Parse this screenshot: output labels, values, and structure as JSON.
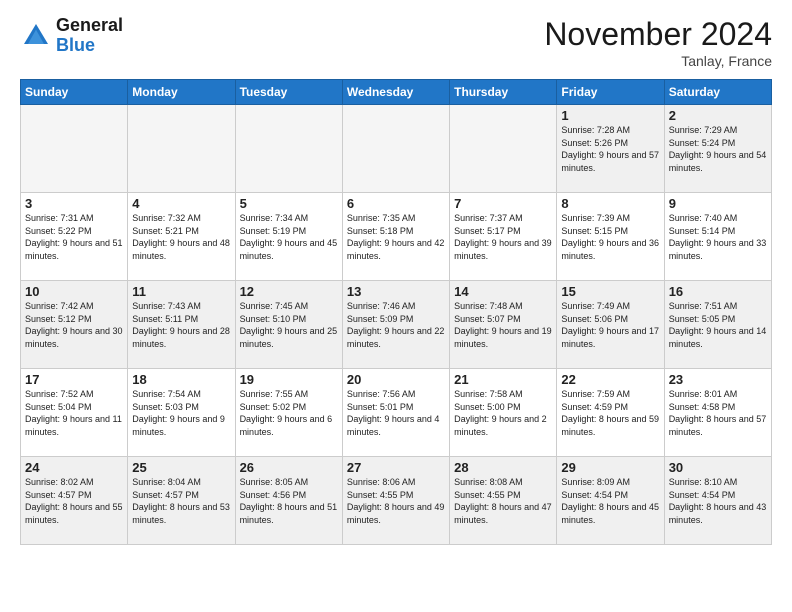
{
  "header": {
    "logo_line1": "General",
    "logo_line2": "Blue",
    "month_title": "November 2024",
    "location": "Tanlay, France"
  },
  "weekdays": [
    "Sunday",
    "Monday",
    "Tuesday",
    "Wednesday",
    "Thursday",
    "Friday",
    "Saturday"
  ],
  "weeks": [
    [
      {
        "day": "",
        "empty": true
      },
      {
        "day": "",
        "empty": true
      },
      {
        "day": "",
        "empty": true
      },
      {
        "day": "",
        "empty": true
      },
      {
        "day": "",
        "empty": true
      },
      {
        "day": "1",
        "sunrise": "7:28 AM",
        "sunset": "5:26 PM",
        "daylight": "9 hours and 57 minutes."
      },
      {
        "day": "2",
        "sunrise": "7:29 AM",
        "sunset": "5:24 PM",
        "daylight": "9 hours and 54 minutes."
      }
    ],
    [
      {
        "day": "3",
        "sunrise": "7:31 AM",
        "sunset": "5:22 PM",
        "daylight": "9 hours and 51 minutes."
      },
      {
        "day": "4",
        "sunrise": "7:32 AM",
        "sunset": "5:21 PM",
        "daylight": "9 hours and 48 minutes."
      },
      {
        "day": "5",
        "sunrise": "7:34 AM",
        "sunset": "5:19 PM",
        "daylight": "9 hours and 45 minutes."
      },
      {
        "day": "6",
        "sunrise": "7:35 AM",
        "sunset": "5:18 PM",
        "daylight": "9 hours and 42 minutes."
      },
      {
        "day": "7",
        "sunrise": "7:37 AM",
        "sunset": "5:17 PM",
        "daylight": "9 hours and 39 minutes."
      },
      {
        "day": "8",
        "sunrise": "7:39 AM",
        "sunset": "5:15 PM",
        "daylight": "9 hours and 36 minutes."
      },
      {
        "day": "9",
        "sunrise": "7:40 AM",
        "sunset": "5:14 PM",
        "daylight": "9 hours and 33 minutes."
      }
    ],
    [
      {
        "day": "10",
        "sunrise": "7:42 AM",
        "sunset": "5:12 PM",
        "daylight": "9 hours and 30 minutes."
      },
      {
        "day": "11",
        "sunrise": "7:43 AM",
        "sunset": "5:11 PM",
        "daylight": "9 hours and 28 minutes."
      },
      {
        "day": "12",
        "sunrise": "7:45 AM",
        "sunset": "5:10 PM",
        "daylight": "9 hours and 25 minutes."
      },
      {
        "day": "13",
        "sunrise": "7:46 AM",
        "sunset": "5:09 PM",
        "daylight": "9 hours and 22 minutes."
      },
      {
        "day": "14",
        "sunrise": "7:48 AM",
        "sunset": "5:07 PM",
        "daylight": "9 hours and 19 minutes."
      },
      {
        "day": "15",
        "sunrise": "7:49 AM",
        "sunset": "5:06 PM",
        "daylight": "9 hours and 17 minutes."
      },
      {
        "day": "16",
        "sunrise": "7:51 AM",
        "sunset": "5:05 PM",
        "daylight": "9 hours and 14 minutes."
      }
    ],
    [
      {
        "day": "17",
        "sunrise": "7:52 AM",
        "sunset": "5:04 PM",
        "daylight": "9 hours and 11 minutes."
      },
      {
        "day": "18",
        "sunrise": "7:54 AM",
        "sunset": "5:03 PM",
        "daylight": "9 hours and 9 minutes."
      },
      {
        "day": "19",
        "sunrise": "7:55 AM",
        "sunset": "5:02 PM",
        "daylight": "9 hours and 6 minutes."
      },
      {
        "day": "20",
        "sunrise": "7:56 AM",
        "sunset": "5:01 PM",
        "daylight": "9 hours and 4 minutes."
      },
      {
        "day": "21",
        "sunrise": "7:58 AM",
        "sunset": "5:00 PM",
        "daylight": "9 hours and 2 minutes."
      },
      {
        "day": "22",
        "sunrise": "7:59 AM",
        "sunset": "4:59 PM",
        "daylight": "8 hours and 59 minutes."
      },
      {
        "day": "23",
        "sunrise": "8:01 AM",
        "sunset": "4:58 PM",
        "daylight": "8 hours and 57 minutes."
      }
    ],
    [
      {
        "day": "24",
        "sunrise": "8:02 AM",
        "sunset": "4:57 PM",
        "daylight": "8 hours and 55 minutes."
      },
      {
        "day": "25",
        "sunrise": "8:04 AM",
        "sunset": "4:57 PM",
        "daylight": "8 hours and 53 minutes."
      },
      {
        "day": "26",
        "sunrise": "8:05 AM",
        "sunset": "4:56 PM",
        "daylight": "8 hours and 51 minutes."
      },
      {
        "day": "27",
        "sunrise": "8:06 AM",
        "sunset": "4:55 PM",
        "daylight": "8 hours and 49 minutes."
      },
      {
        "day": "28",
        "sunrise": "8:08 AM",
        "sunset": "4:55 PM",
        "daylight": "8 hours and 47 minutes."
      },
      {
        "day": "29",
        "sunrise": "8:09 AM",
        "sunset": "4:54 PM",
        "daylight": "8 hours and 45 minutes."
      },
      {
        "day": "30",
        "sunrise": "8:10 AM",
        "sunset": "4:54 PM",
        "daylight": "8 hours and 43 minutes."
      }
    ]
  ]
}
